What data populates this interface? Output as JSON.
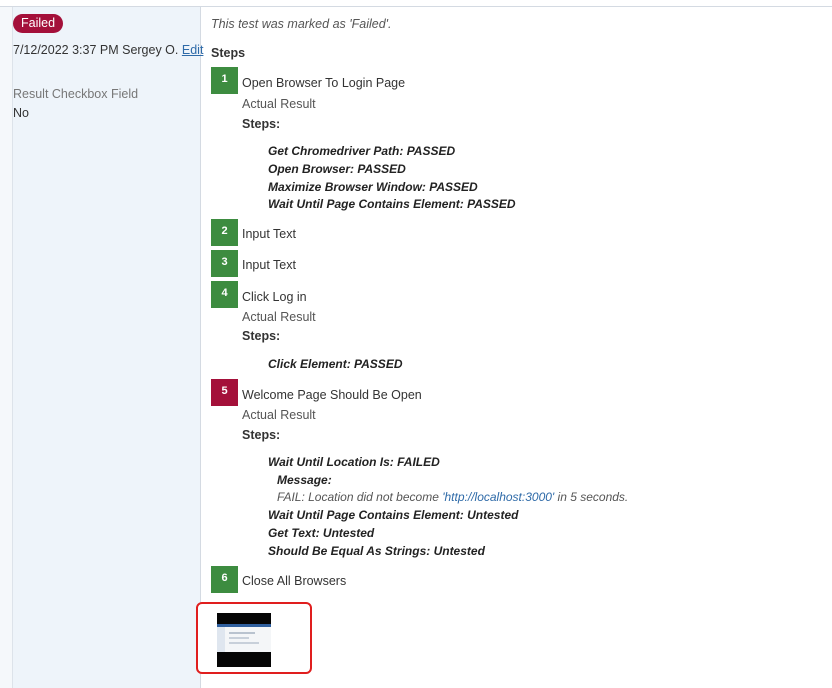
{
  "result": {
    "status_badge": "Failed",
    "timestamp_user": "7/12/2022 3:37 PM Sergey O.",
    "edit_link": "Edit",
    "custom_field": {
      "label": "Result Checkbox Field",
      "value": "No"
    }
  },
  "details": {
    "note": "This test was marked as 'Failed'.",
    "steps_heading": "Steps",
    "actual_result_label": "Actual Result",
    "steps_label": "Steps:",
    "steps": [
      {
        "number": "1",
        "status": "passed",
        "title": "Open Browser To Login Page",
        "keywords": [
          "Get Chromedriver Path: PASSED",
          "Open Browser: PASSED",
          "Maximize Browser Window: PASSED",
          "Wait Until Page Contains Element: PASSED"
        ]
      },
      {
        "number": "2",
        "status": "passed",
        "title": "Input Text"
      },
      {
        "number": "3",
        "status": "passed",
        "title": "Input Text"
      },
      {
        "number": "4",
        "status": "passed",
        "title": "Click Log in",
        "keywords": [
          "Click Element: PASSED"
        ]
      },
      {
        "number": "5",
        "status": "failed",
        "title": "Welcome Page Should Be Open",
        "keywords": [
          "Wait Until Location Is: FAILED",
          "Wait Until Page Contains Element: Untested",
          "Get Text: Untested",
          "Should Be Equal As Strings: Untested"
        ],
        "message_label": "Message:",
        "message_prefix": "FAIL: Location did not become ",
        "message_url": "'http://localhost:3000'",
        "message_suffix": " in 5 seconds."
      },
      {
        "number": "6",
        "status": "passed",
        "title": "Close All Browsers"
      }
    ]
  },
  "colors": {
    "passed": "#3d8c40",
    "failed": "#a4103a",
    "highlight_border": "#e01e1e",
    "link": "#2e6aa8"
  }
}
